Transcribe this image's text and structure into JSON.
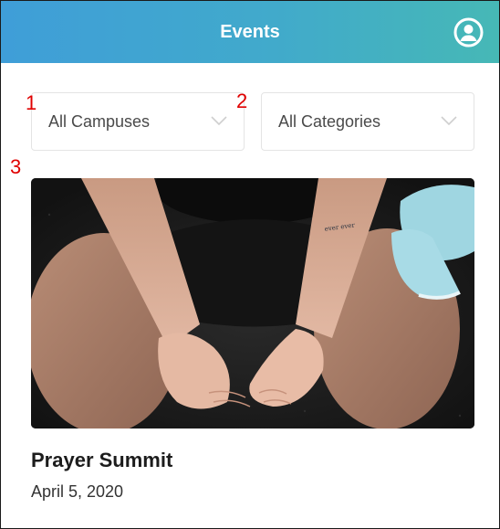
{
  "header": {
    "title": "Events",
    "profile_icon": "user-circle-icon",
    "gradient_start": "#3f9ed8",
    "gradient_end": "#46b8b6"
  },
  "filters": {
    "campus": {
      "selected": "All Campuses",
      "icon": "chevron-down-icon"
    },
    "category": {
      "selected": "All Categories",
      "icon": "chevron-down-icon"
    }
  },
  "annotations": {
    "marker_1": "1",
    "marker_2": "2",
    "marker_3": "3",
    "marker_color": "#e00000"
  },
  "event": {
    "title": "Prayer Summit",
    "date": "April 5, 2020"
  }
}
